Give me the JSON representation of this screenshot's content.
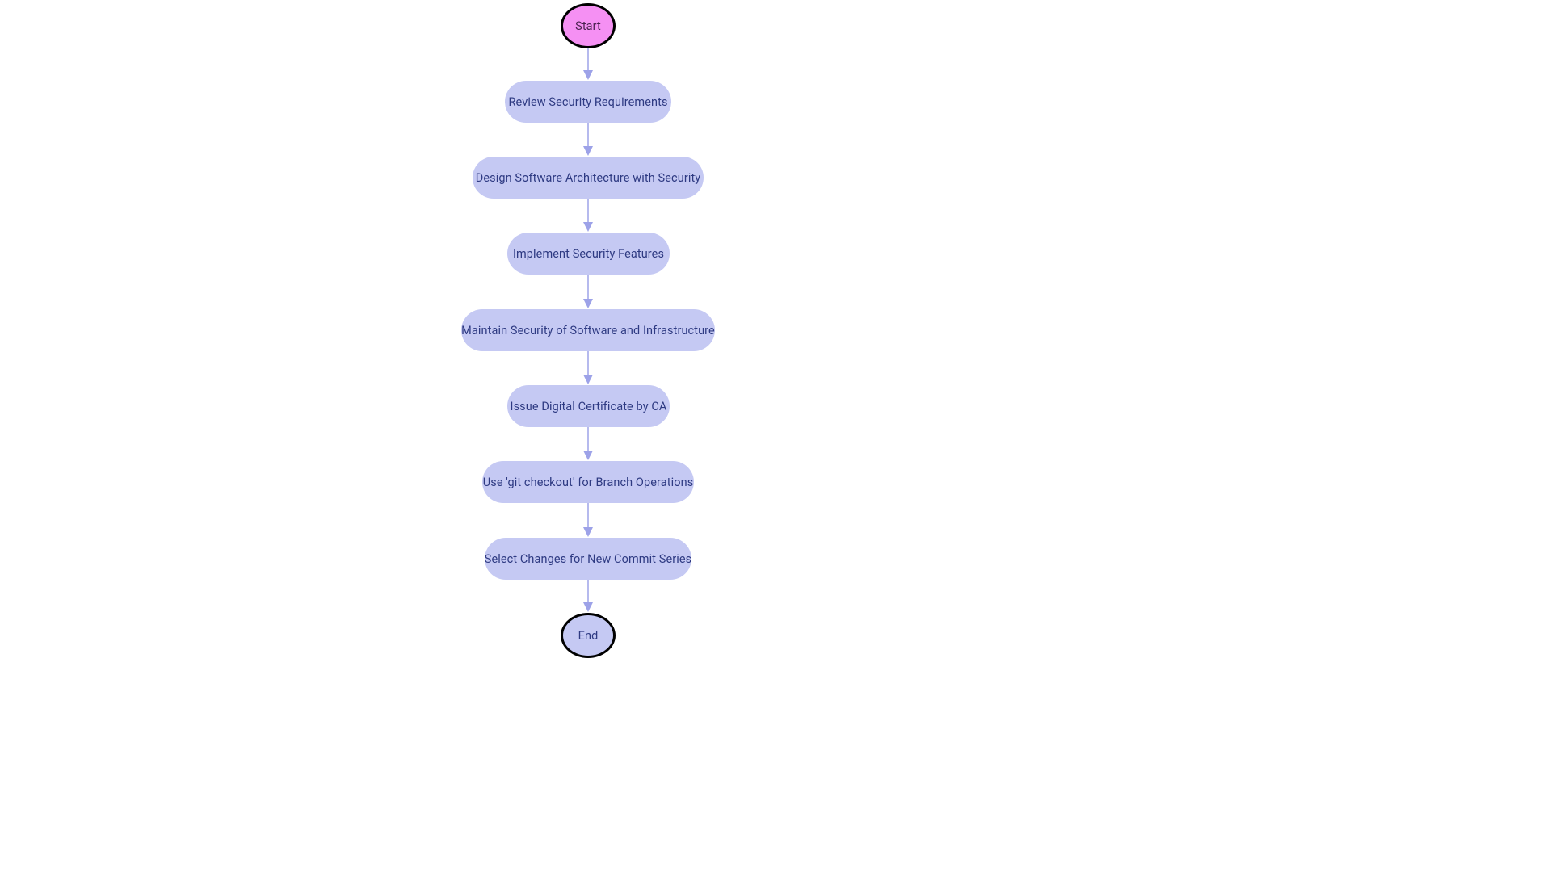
{
  "flowchart": {
    "type": "flowchart",
    "direction": "top-down",
    "nodes": [
      {
        "id": "start",
        "kind": "terminal",
        "label": "Start"
      },
      {
        "id": "n1",
        "kind": "process",
        "label": "Review Security Requirements"
      },
      {
        "id": "n2",
        "kind": "process",
        "label": "Design Software Architecture with Security"
      },
      {
        "id": "n3",
        "kind": "process",
        "label": "Implement Security Features"
      },
      {
        "id": "n4",
        "kind": "process",
        "label": "Maintain Security of Software and Infrastructure"
      },
      {
        "id": "n5",
        "kind": "process",
        "label": "Issue Digital Certificate by CA"
      },
      {
        "id": "n6",
        "kind": "process",
        "label": "Use 'git checkout' for Branch Operations"
      },
      {
        "id": "n7",
        "kind": "process",
        "label": "Select Changes for New Commit Series"
      },
      {
        "id": "end",
        "kind": "terminal",
        "label": "End"
      }
    ],
    "edges": [
      [
        "start",
        "n1"
      ],
      [
        "n1",
        "n2"
      ],
      [
        "n2",
        "n3"
      ],
      [
        "n3",
        "n4"
      ],
      [
        "n4",
        "n5"
      ],
      [
        "n5",
        "n6"
      ],
      [
        "n6",
        "n7"
      ],
      [
        "n7",
        "end"
      ]
    ],
    "colors": {
      "process_fill": "#c5c9f3",
      "terminal_start_fill": "#f590f3",
      "terminal_end_fill": "#c5c9f3",
      "terminal_border": "#000000",
      "text": "#2e3a82",
      "arrow": "#9da2e8"
    }
  }
}
